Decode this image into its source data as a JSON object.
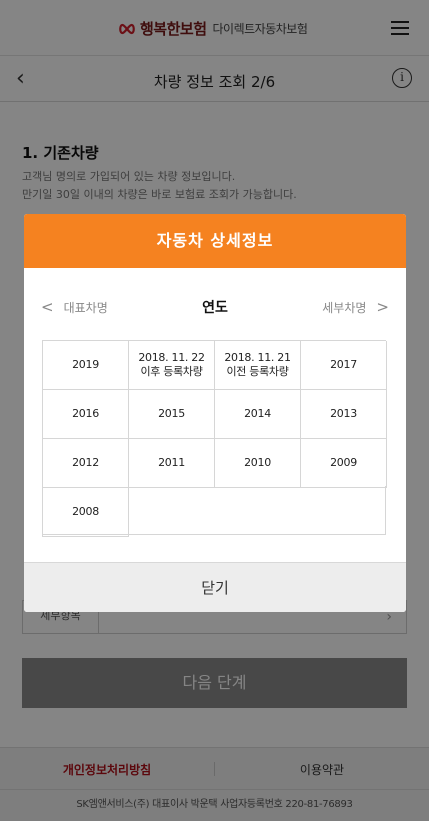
{
  "header": {
    "brand_name": "행복한보험",
    "brand_sub": "다이렉트자동차보험"
  },
  "subheader": {
    "title": "차량 정보 조회 2/6"
  },
  "page": {
    "section_title": "1. 기존차량",
    "desc_line1": "고객님 명의로 가입되어 있는 차량 정보입니다.",
    "desc_line2": "만기일 30일 이내의 차량은 바로 보험료 조회가 가능합니다.",
    "sub_field_label": "세부항목",
    "next_button": "다음 단계"
  },
  "modal": {
    "title": "자동차 상세정보",
    "nav_prev": "대표차명",
    "nav_current": "연도",
    "nav_next": "세부차명",
    "years": [
      "2019",
      "2018. 11. 22 이후 등록차량",
      "2018. 11. 21 이전 등록차량",
      "2017",
      "2016",
      "2015",
      "2014",
      "2013",
      "2012",
      "2011",
      "2010",
      "2009",
      "2008"
    ],
    "close": "닫기"
  },
  "footer": {
    "privacy": "개인정보처리방침",
    "terms": "이용약관",
    "company": "SK엠앤서비스(주) 대표이사 박운택 사업자등록번호 220-81-76893"
  },
  "colors": {
    "brand_accent": "#f58220",
    "privacy_link": "#b0101a",
    "logo_red": "#d01f2b"
  }
}
